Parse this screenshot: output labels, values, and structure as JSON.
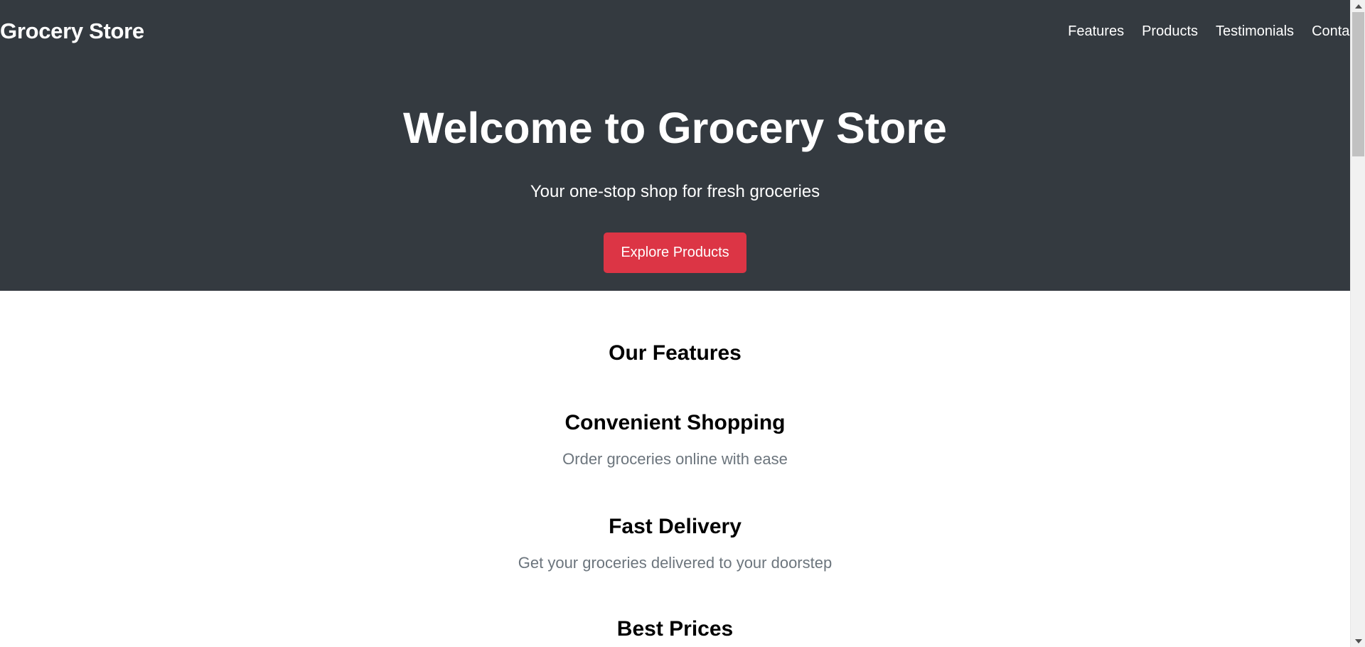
{
  "header": {
    "brand": "Grocery Store",
    "nav": {
      "features": "Features",
      "products": "Products",
      "testimonials": "Testimonials",
      "contact": "Contact"
    }
  },
  "hero": {
    "title": "Welcome to Grocery Store",
    "subtitle": "Your one-stop shop for fresh groceries",
    "cta_label": "Explore Products"
  },
  "features": {
    "title": "Our Features",
    "items": [
      {
        "heading": "Convenient Shopping",
        "description": "Order groceries online with ease"
      },
      {
        "heading": "Fast Delivery",
        "description": "Get your groceries delivered to your doorstep"
      },
      {
        "heading": "Best Prices",
        "description": ""
      }
    ]
  },
  "colors": {
    "header_bg": "#343a40",
    "accent": "#dc3545",
    "muted_text": "#6c757d"
  },
  "icons": {
    "scroll_up": "scroll-up-arrow-icon",
    "scroll_down": "scroll-down-arrow-icon"
  }
}
